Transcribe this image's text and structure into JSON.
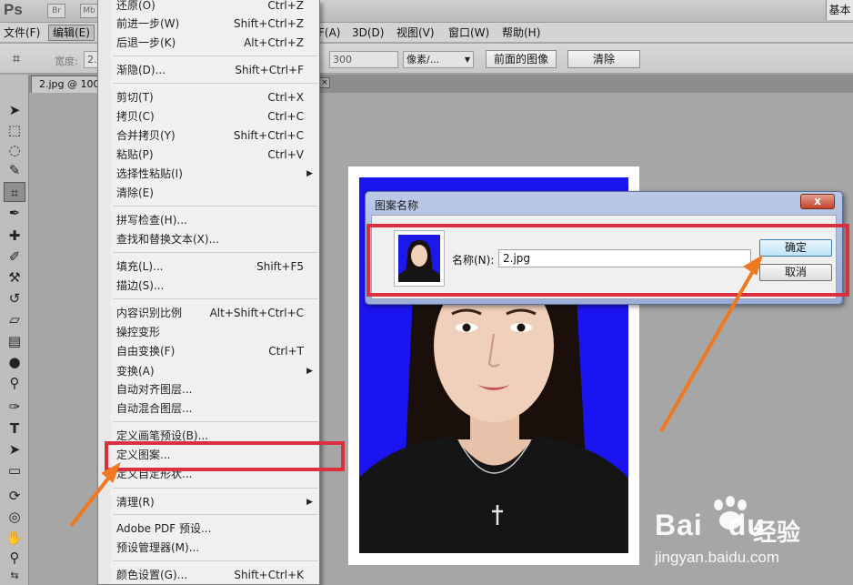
{
  "app": {
    "logo": "Ps",
    "bridge": "Br",
    "minibridge": "Mb",
    "workspace": "基本"
  },
  "menubar": {
    "file": "文件(F)",
    "edit": "编辑(E)",
    "filter": "F(A)",
    "threed": "3D(D)",
    "view": "视图(V)",
    "window": "窗口(W)",
    "help": "帮助(H)"
  },
  "options": {
    "width_label": "宽度:",
    "width_value": "2.",
    "resolution_value": "300",
    "unit_select": "像素/...",
    "front_image": "前面的图像",
    "clear": "清除"
  },
  "document_tab": {
    "title": "2.jpg @ 100",
    "close": "×"
  },
  "edit_menu": {
    "items": [
      {
        "label": "还原(O)",
        "shortcut": "Ctrl+Z"
      },
      {
        "label": "前进一步(W)",
        "shortcut": "Shift+Ctrl+Z"
      },
      {
        "label": "后退一步(K)",
        "shortcut": "Alt+Ctrl+Z"
      },
      {
        "label": "渐隐(D)...",
        "shortcut": "Shift+Ctrl+F"
      },
      {
        "label": "剪切(T)",
        "shortcut": "Ctrl+X"
      },
      {
        "label": "拷贝(C)",
        "shortcut": "Ctrl+C"
      },
      {
        "label": "合并拷贝(Y)",
        "shortcut": "Shift+Ctrl+C"
      },
      {
        "label": "粘贴(P)",
        "shortcut": "Ctrl+V"
      },
      {
        "label": "选择性粘贴(I)",
        "shortcut": ""
      },
      {
        "label": "清除(E)",
        "shortcut": ""
      },
      {
        "label": "拼写检查(H)...",
        "shortcut": ""
      },
      {
        "label": "查找和替换文本(X)...",
        "shortcut": ""
      },
      {
        "label": "填充(L)...",
        "shortcut": "Shift+F5"
      },
      {
        "label": "描边(S)...",
        "shortcut": ""
      },
      {
        "label": "内容识别比例",
        "shortcut": "Alt+Shift+Ctrl+C"
      },
      {
        "label": "操控变形",
        "shortcut": ""
      },
      {
        "label": "自由变换(F)",
        "shortcut": "Ctrl+T"
      },
      {
        "label": "变换(A)",
        "shortcut": ""
      },
      {
        "label": "自动对齐图层...",
        "shortcut": ""
      },
      {
        "label": "自动混合图层...",
        "shortcut": ""
      },
      {
        "label": "定义画笔预设(B)...",
        "shortcut": ""
      },
      {
        "label": "定义图案...",
        "shortcut": ""
      },
      {
        "label": "定义自定形状...",
        "shortcut": ""
      },
      {
        "label": "清理(R)",
        "shortcut": ""
      },
      {
        "label": "Adobe PDF 预设...",
        "shortcut": ""
      },
      {
        "label": "预设管理器(M)...",
        "shortcut": ""
      },
      {
        "label": "颜色设置(G)...",
        "shortcut": "Shift+Ctrl+K"
      }
    ]
  },
  "dialog": {
    "title": "图案名称",
    "close": "x",
    "name_label": "名称(N):",
    "name_value": "2.jpg",
    "ok": "确定",
    "cancel": "取消"
  },
  "watermark": {
    "brand": "Bai",
    "brand_tail": "du",
    "cn": "经验",
    "url": "jingyan.baidu.com"
  },
  "colors": {
    "highlight": "#d8303e",
    "arrow": "#f07820",
    "photo_background": "#1a14f0"
  }
}
